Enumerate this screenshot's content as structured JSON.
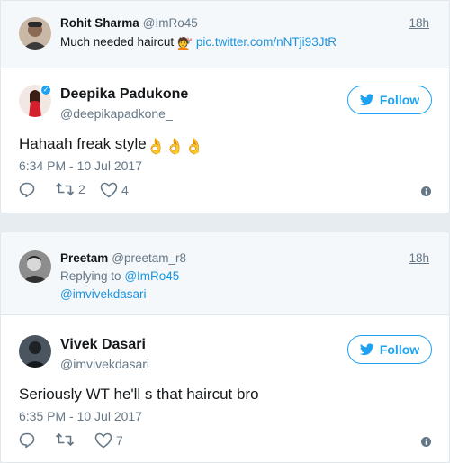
{
  "tweet1": {
    "context": {
      "name": "Rohit Sharma",
      "handle": "@ImRo45",
      "time": "18h",
      "text": "Much needed haircut",
      "emoji": "💇",
      "link": "pic.twitter.com/nNTji93JtR"
    },
    "author": {
      "name": "Deepika Padukone",
      "handle": "@deepikapadkone_",
      "verified_badge": "✓"
    },
    "follow_label": "Follow",
    "text": "Hahaah freak style",
    "text_emoji": "👌👌👌",
    "timestamp": "6:34 PM - 10 Jul 2017",
    "retweets": "2",
    "likes": "4"
  },
  "tweet2": {
    "context": {
      "name": "Preetam",
      "handle": "@preetam_r8",
      "time": "18h",
      "replying_prefix": "Replying to",
      "replying_to": "@ImRo45",
      "mention": "@imvivekdasari"
    },
    "author": {
      "name": "Vivek Dasari",
      "handle": "@imvivekdasari"
    },
    "follow_label": "Follow",
    "text": "Seriously WT he'll s that haircut bro",
    "timestamp": "6:35 PM - 10 Jul 2017",
    "retweets": "",
    "likes": "7"
  },
  "colors": {
    "accent": "#1da1f2",
    "link": "#1b95e0",
    "muted": "#657786",
    "text": "#14171a",
    "background": "#e6ecf0"
  },
  "icons": [
    "reply-icon",
    "retweet-icon",
    "heart-icon",
    "info-icon",
    "twitter-bird-icon"
  ]
}
